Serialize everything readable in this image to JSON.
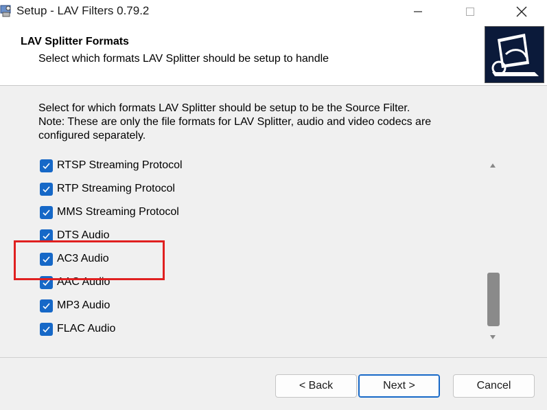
{
  "window": {
    "title": "Setup - LAV Filters 0.79.2"
  },
  "header": {
    "title": "LAV Splitter Formats",
    "subtitle": "Select which formats LAV Splitter should be setup to handle"
  },
  "description": {
    "line1": "Select for which formats LAV Splitter should be setup to be the Source Filter.",
    "line2": "Note: These are only the file formats for LAV Splitter, audio and video codecs are",
    "line3": "configured separately."
  },
  "formats": [
    {
      "label": "RTSP Streaming Protocol",
      "checked": true
    },
    {
      "label": "RTP Streaming Protocol",
      "checked": true
    },
    {
      "label": "MMS Streaming Protocol",
      "checked": true
    },
    {
      "label": "DTS Audio",
      "checked": true
    },
    {
      "label": "AC3 Audio",
      "checked": true
    },
    {
      "label": "AAC Audio",
      "checked": true
    },
    {
      "label": "MP3 Audio",
      "checked": true
    },
    {
      "label": "FLAC Audio",
      "checked": true
    }
  ],
  "buttons": {
    "back": "< Back",
    "next": "Next >",
    "cancel": "Cancel"
  },
  "colors": {
    "checkbox": "#1668c7",
    "highlight": "#e02020"
  }
}
